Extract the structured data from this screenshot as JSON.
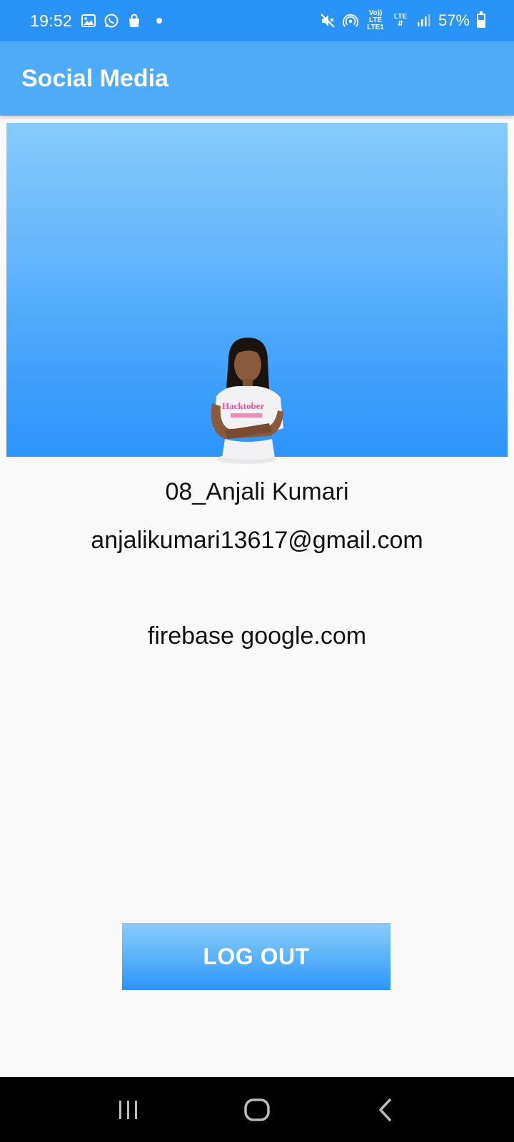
{
  "status_bar": {
    "time": "19:52",
    "left_icons": [
      "gallery-icon",
      "whatsapp-icon",
      "shopping-bag-icon",
      "notification-dot-icon"
    ],
    "network_top": "Vo)) LTE",
    "network_bottom": "LTE1",
    "lte_label": "LTE",
    "battery_percent": "57%",
    "battery_level": 0.57,
    "right_icons": [
      "mute-icon",
      "hotspot-icon",
      "volte-icon",
      "signal-icon",
      "battery-icon"
    ]
  },
  "app_bar": {
    "title": "Social Media",
    "color": "#4dabf8"
  },
  "profile": {
    "name": "08_Anjali Kumari",
    "email": "anjalikumari13617@gmail.com",
    "provider": "firebase google.com"
  },
  "actions": {
    "logout_label": "LOG OUT"
  },
  "nav_bar": {
    "buttons": [
      "recent-apps-icon",
      "home-icon",
      "back-icon"
    ]
  },
  "colors": {
    "status_bar": "#2a93f7",
    "accent": "#2c94fb",
    "background": "#f9f9f9"
  }
}
